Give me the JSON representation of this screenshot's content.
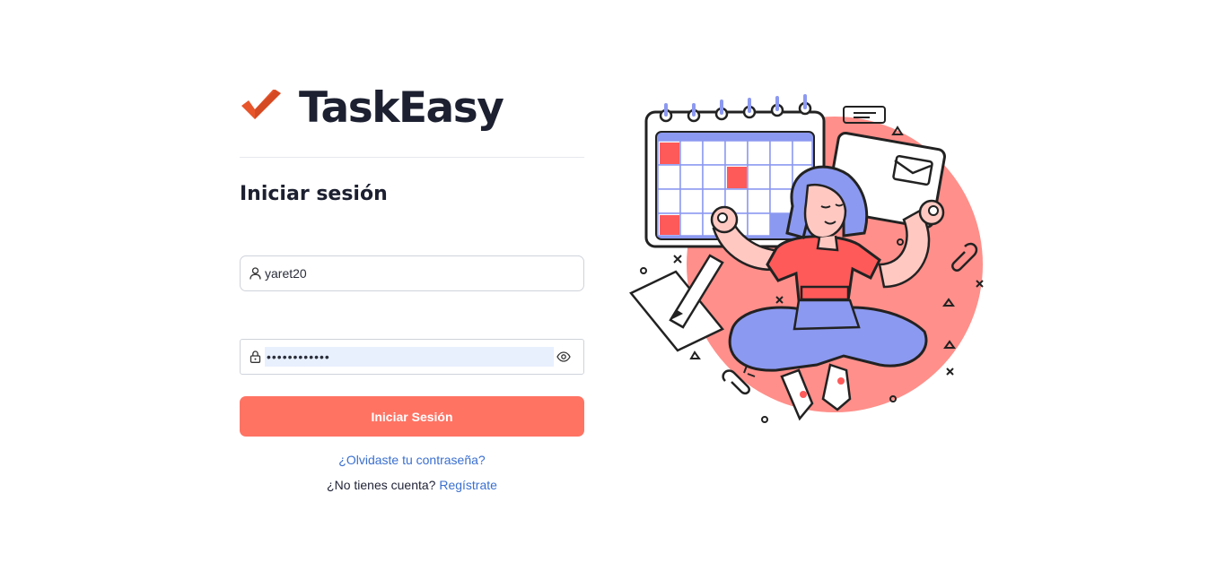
{
  "brand": {
    "name": "TaskEasy",
    "logo_icon": "checkmark-icon",
    "logo_color": "#e8552b"
  },
  "login": {
    "title": "Iniciar sesión",
    "username_value": "yaret20",
    "username_icon": "user-icon",
    "password_value": "passwordxxxx",
    "password_icon": "lock-icon",
    "toggle_icon": "eye-icon",
    "submit_label": "Iniciar Sesión",
    "forgot_label": "¿Olvidaste tu contraseña?",
    "signup_prompt": "¿No tienes cuenta?",
    "signup_link": "Regístrate"
  },
  "colors": {
    "accent": "#ff7363",
    "link": "#3a6fcf",
    "autofill": "#e8f0fe"
  },
  "illustration": {
    "name": "woman-meditating-with-calendar-illustration"
  }
}
